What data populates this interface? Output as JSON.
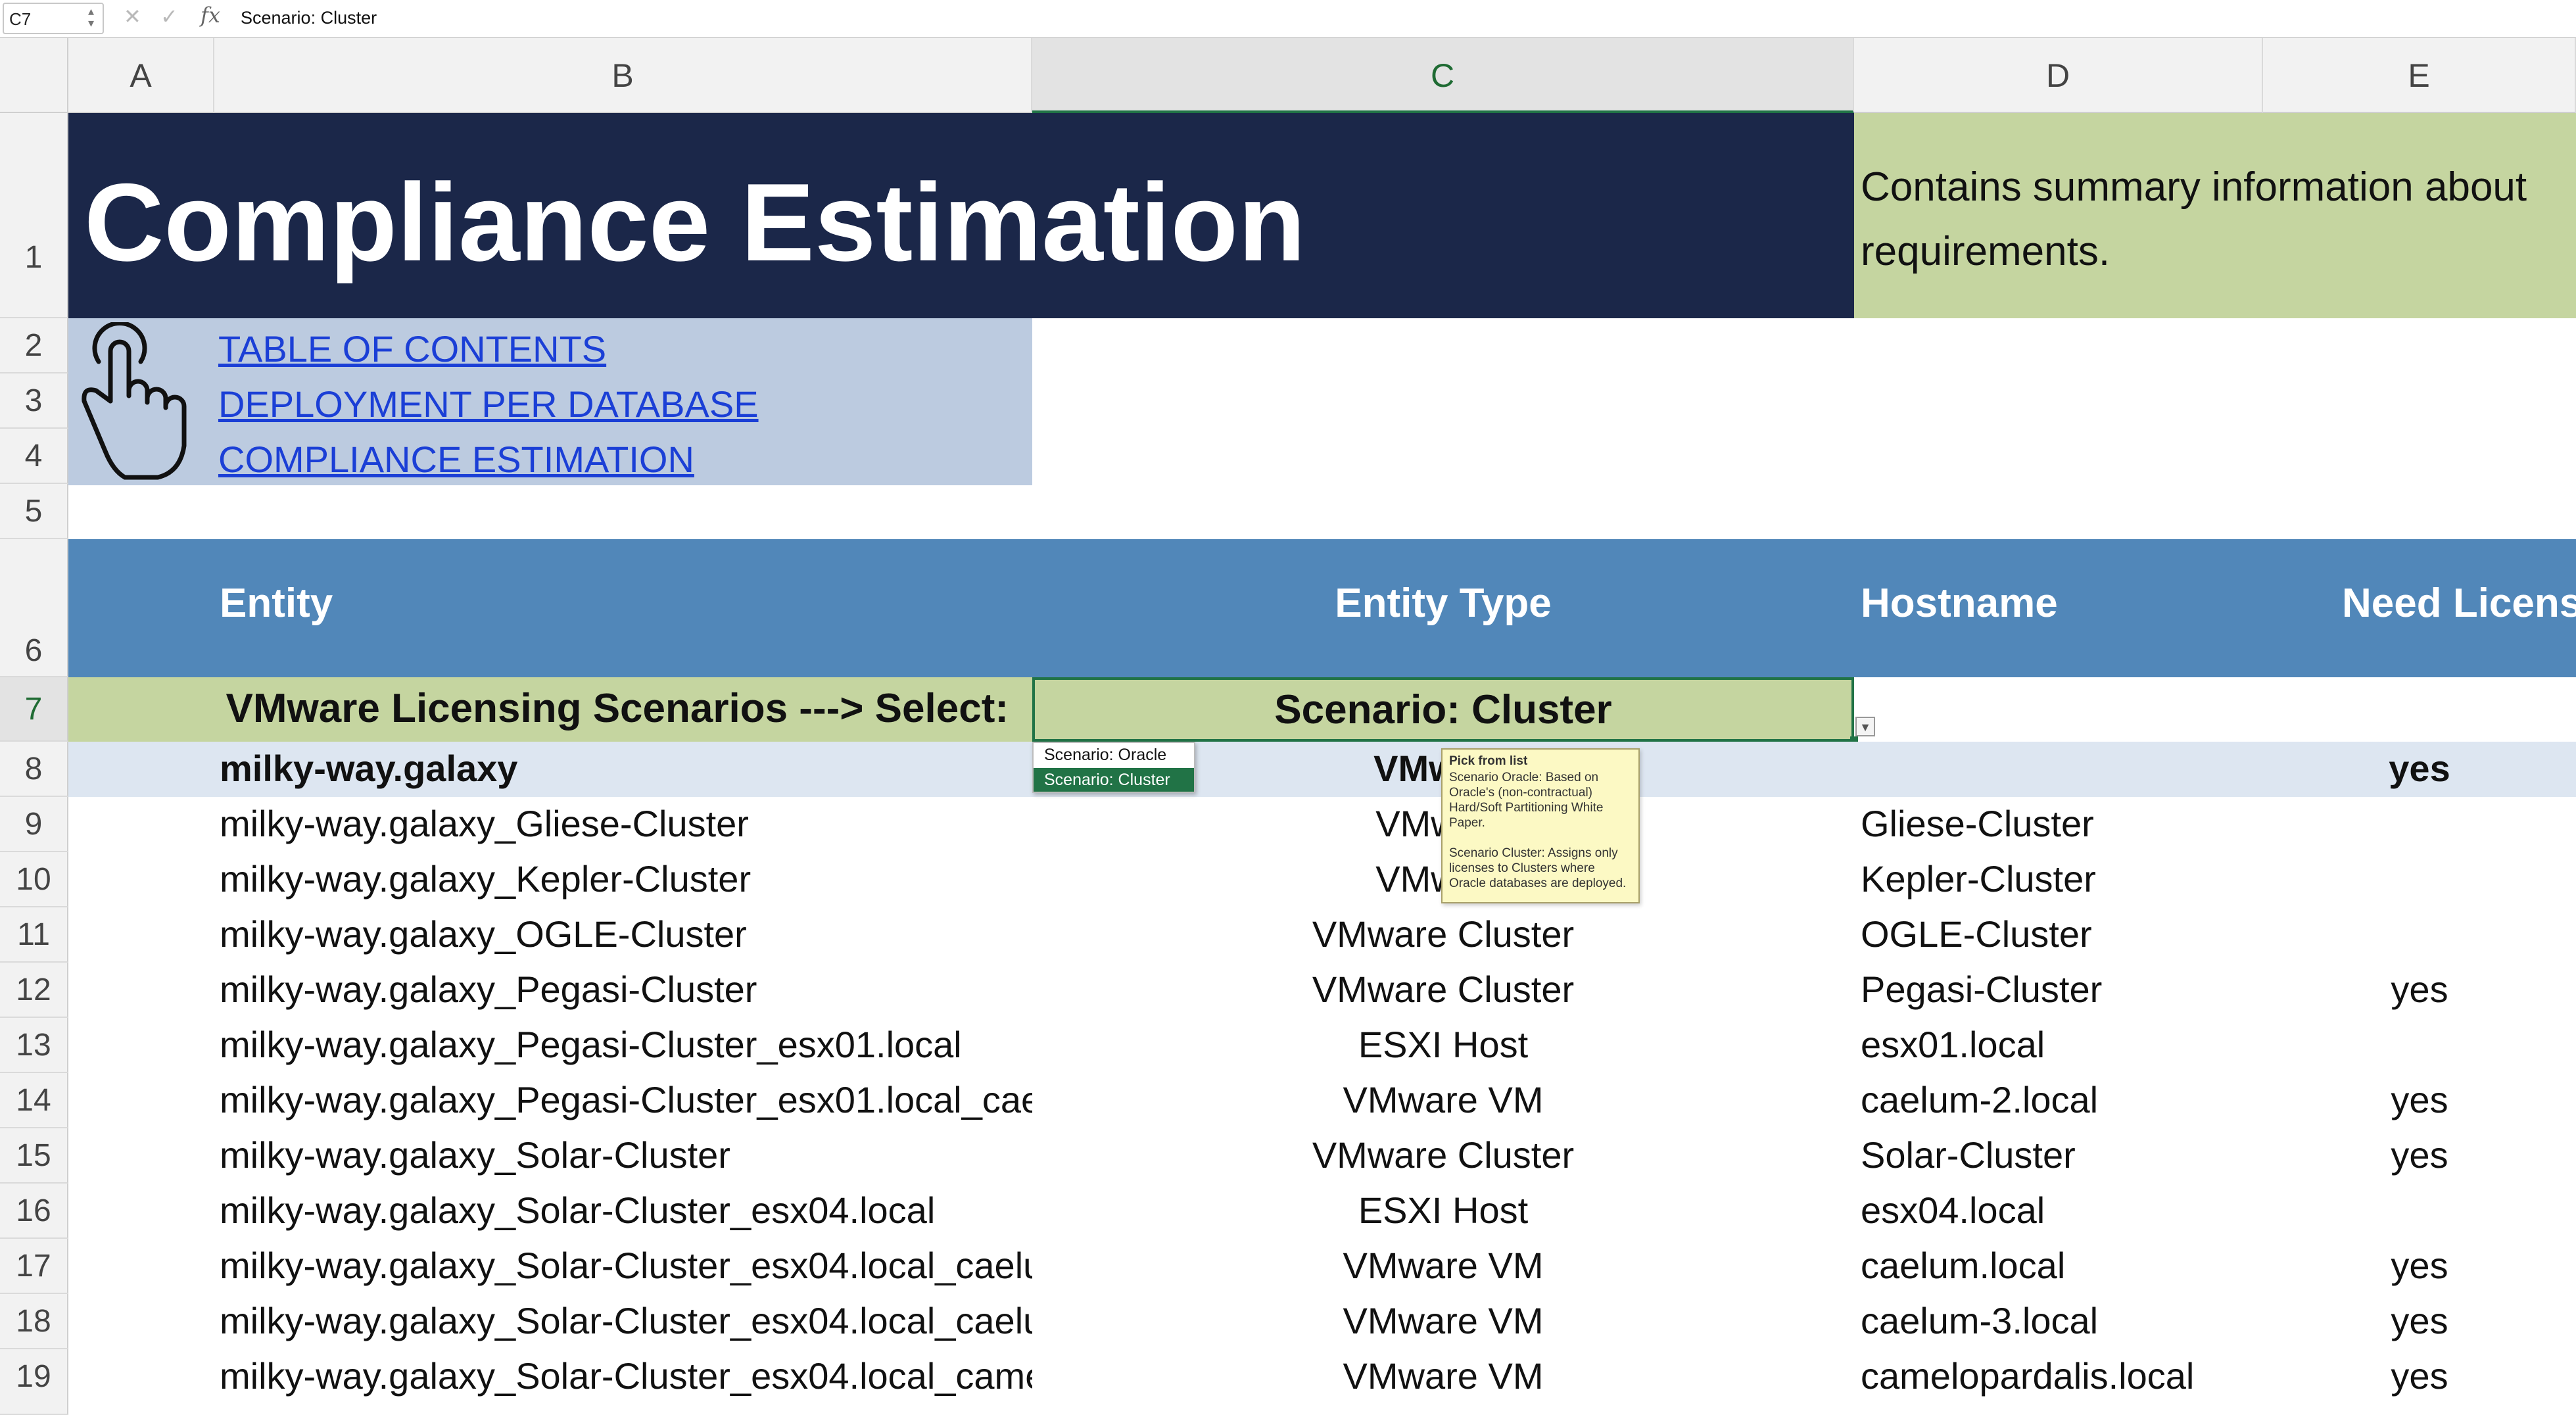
{
  "formula_bar": {
    "cell_ref": "C7",
    "fx": "fx",
    "content": "Scenario: Cluster"
  },
  "columns": [
    "A",
    "B",
    "C",
    "D",
    "E"
  ],
  "rows": [
    "1",
    "2",
    "3",
    "4",
    "5",
    "6",
    "7",
    "8",
    "9",
    "10",
    "11",
    "12",
    "13",
    "14",
    "15",
    "16",
    "17",
    "18",
    "19"
  ],
  "title": "Compliance Estimation",
  "summary": "Contains summary information about requirements.",
  "summary_line1": "Contains summary information about",
  "summary_line2": "requirements.",
  "nav_links": [
    "TABLE OF CONTENTS",
    "DEPLOYMENT PER DATABASE",
    "COMPLIANCE ESTIMATION"
  ],
  "table_header": {
    "entity": "Entity",
    "entity_type": "Entity Type",
    "hostname": "Hostname",
    "need_license": "Need Licens"
  },
  "scenario_row": {
    "label": "VMware Licensing Scenarios ---> Select:",
    "value": "Scenario: Cluster"
  },
  "dropdown": {
    "options": [
      "Scenario: Oracle",
      "Scenario: Cluster"
    ],
    "selected": "Scenario: Cluster"
  },
  "tooltip": {
    "title": "Pick from list",
    "text1": "Scenario Oracle: Based on Oracle's (non-contractual) Hard/Soft Partitioning White Paper.",
    "text2": "Scenario Cluster: Assigns only licenses to Clusters where Oracle databases are deployed."
  },
  "data_rows": [
    {
      "entity": "milky-way.galaxy",
      "type": "VMware",
      "hostname": "",
      "need": "yes"
    },
    {
      "entity": "milky-way.galaxy_Gliese-Cluster",
      "type": "VMware",
      "hostname": "Gliese-Cluster",
      "need": ""
    },
    {
      "entity": "milky-way.galaxy_Kepler-Cluster",
      "type": "VMware",
      "hostname": "Kepler-Cluster",
      "need": ""
    },
    {
      "entity": "milky-way.galaxy_OGLE-Cluster",
      "type": "VMware Cluster",
      "hostname": "OGLE-Cluster",
      "need": ""
    },
    {
      "entity": "milky-way.galaxy_Pegasi-Cluster",
      "type": "VMware Cluster",
      "hostname": "Pegasi-Cluster",
      "need": "yes"
    },
    {
      "entity": "milky-way.galaxy_Pegasi-Cluster_esx01.local",
      "type": "ESXI Host",
      "hostname": "esx01.local",
      "need": ""
    },
    {
      "entity": "milky-way.galaxy_Pegasi-Cluster_esx01.local_cae",
      "type": "VMware VM",
      "hostname": "caelum-2.local",
      "need": "yes"
    },
    {
      "entity": "milky-way.galaxy_Solar-Cluster",
      "type": "VMware Cluster",
      "hostname": "Solar-Cluster",
      "need": "yes"
    },
    {
      "entity": "milky-way.galaxy_Solar-Cluster_esx04.local",
      "type": "ESXI Host",
      "hostname": "esx04.local",
      "need": ""
    },
    {
      "entity": "milky-way.galaxy_Solar-Cluster_esx04.local_caelu",
      "type": "VMware VM",
      "hostname": "caelum.local",
      "need": "yes"
    },
    {
      "entity": "milky-way.galaxy_Solar-Cluster_esx04.local_caelu",
      "type": "VMware VM",
      "hostname": "caelum-3.local",
      "need": "yes"
    },
    {
      "entity": "milky-way.galaxy_Solar-Cluster_esx04.local_came",
      "type": "VMware VM",
      "hostname": "camelopardalis.local",
      "need": "yes"
    }
  ],
  "colors": {
    "title_bg": "#1b2749",
    "summary_bg": "#c5d5a0",
    "nav_bg": "#bccbe0",
    "header_bg": "#5187b9",
    "scenario_bg": "#c5d5a0",
    "row8_bg": "#dde6f1",
    "link": "#1b3fd6"
  }
}
